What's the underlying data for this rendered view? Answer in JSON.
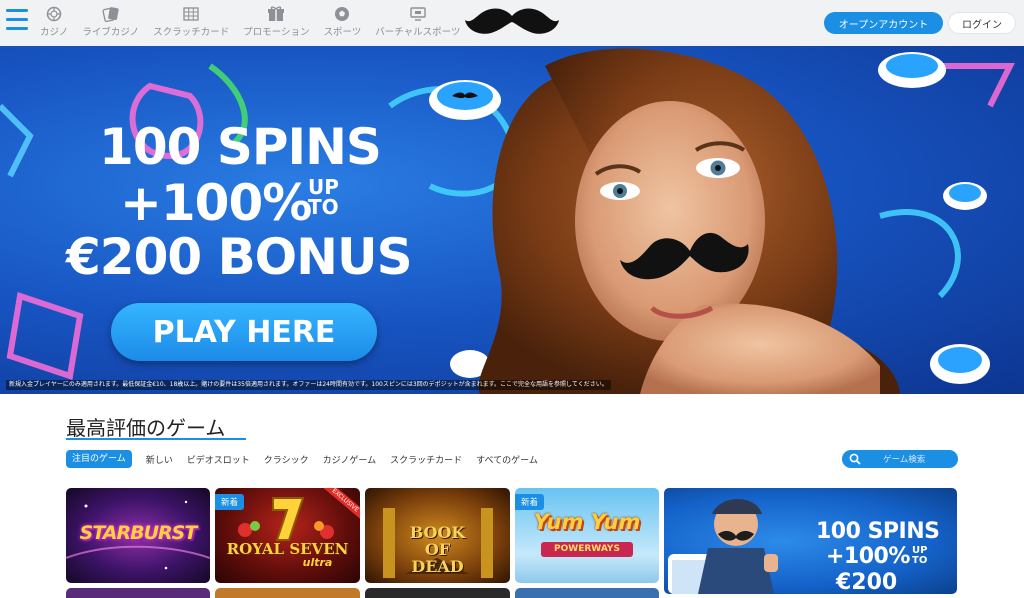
{
  "header": {
    "nav": [
      {
        "label": "カジノ",
        "icon": "casino-chip-icon"
      },
      {
        "label": "ライブカジノ",
        "icon": "cards-icon"
      },
      {
        "label": "スクラッチカード",
        "icon": "grid-icon"
      },
      {
        "label": "プロモーション",
        "icon": "gift-icon"
      },
      {
        "label": "スポーツ",
        "icon": "soccer-ball-icon"
      },
      {
        "label": "バーチャルスポーツ",
        "icon": "virtual-screen-icon"
      }
    ],
    "open_account": "オープンアカウント",
    "login": "ログイン"
  },
  "banner": {
    "line1": "100 SPINS",
    "line2": "+100%",
    "upto_1": "UP",
    "upto_2": "TO",
    "line3": "€200 BONUS",
    "cta": "PLAY HERE",
    "disclaimer": "新規入金プレイヤーにのみ適用されます。最低保証金€10、18歳以上。賭けの要件は35倍適用されます。オファーは24時間有効です。100スピンには3回のデポジットが含まれます。ここで完全な用語を参照してください。"
  },
  "games_section": {
    "title": "最高評価のゲーム",
    "filters": [
      "注目のゲーム",
      "新しい",
      "ビデオスロット",
      "クラシック",
      "カジノゲーム",
      "スクラッチカード",
      "すべてのゲーム"
    ],
    "search_placeholder": "ゲーム検索",
    "tiles": [
      {
        "name": "STARBURST",
        "badge": ""
      },
      {
        "name": "ROYAL SEVEN",
        "sub": "ultra",
        "badge": "新着",
        "ribbon": "EXCLUSIVE"
      },
      {
        "name": "BOOK OF DEAD",
        "badge": ""
      },
      {
        "name": "Yum Yum",
        "sub": "POWERWAYS",
        "badge": "新着"
      }
    ],
    "promo": {
      "line1": "100 SPINS",
      "line2": "+100%",
      "upto_1": "UP",
      "upto_2": "TO",
      "line3": "€200"
    }
  },
  "colors": {
    "accent": "#1a8fe3",
    "header_bg": "#f1f2f4",
    "banner_blue": "#1856c4"
  }
}
